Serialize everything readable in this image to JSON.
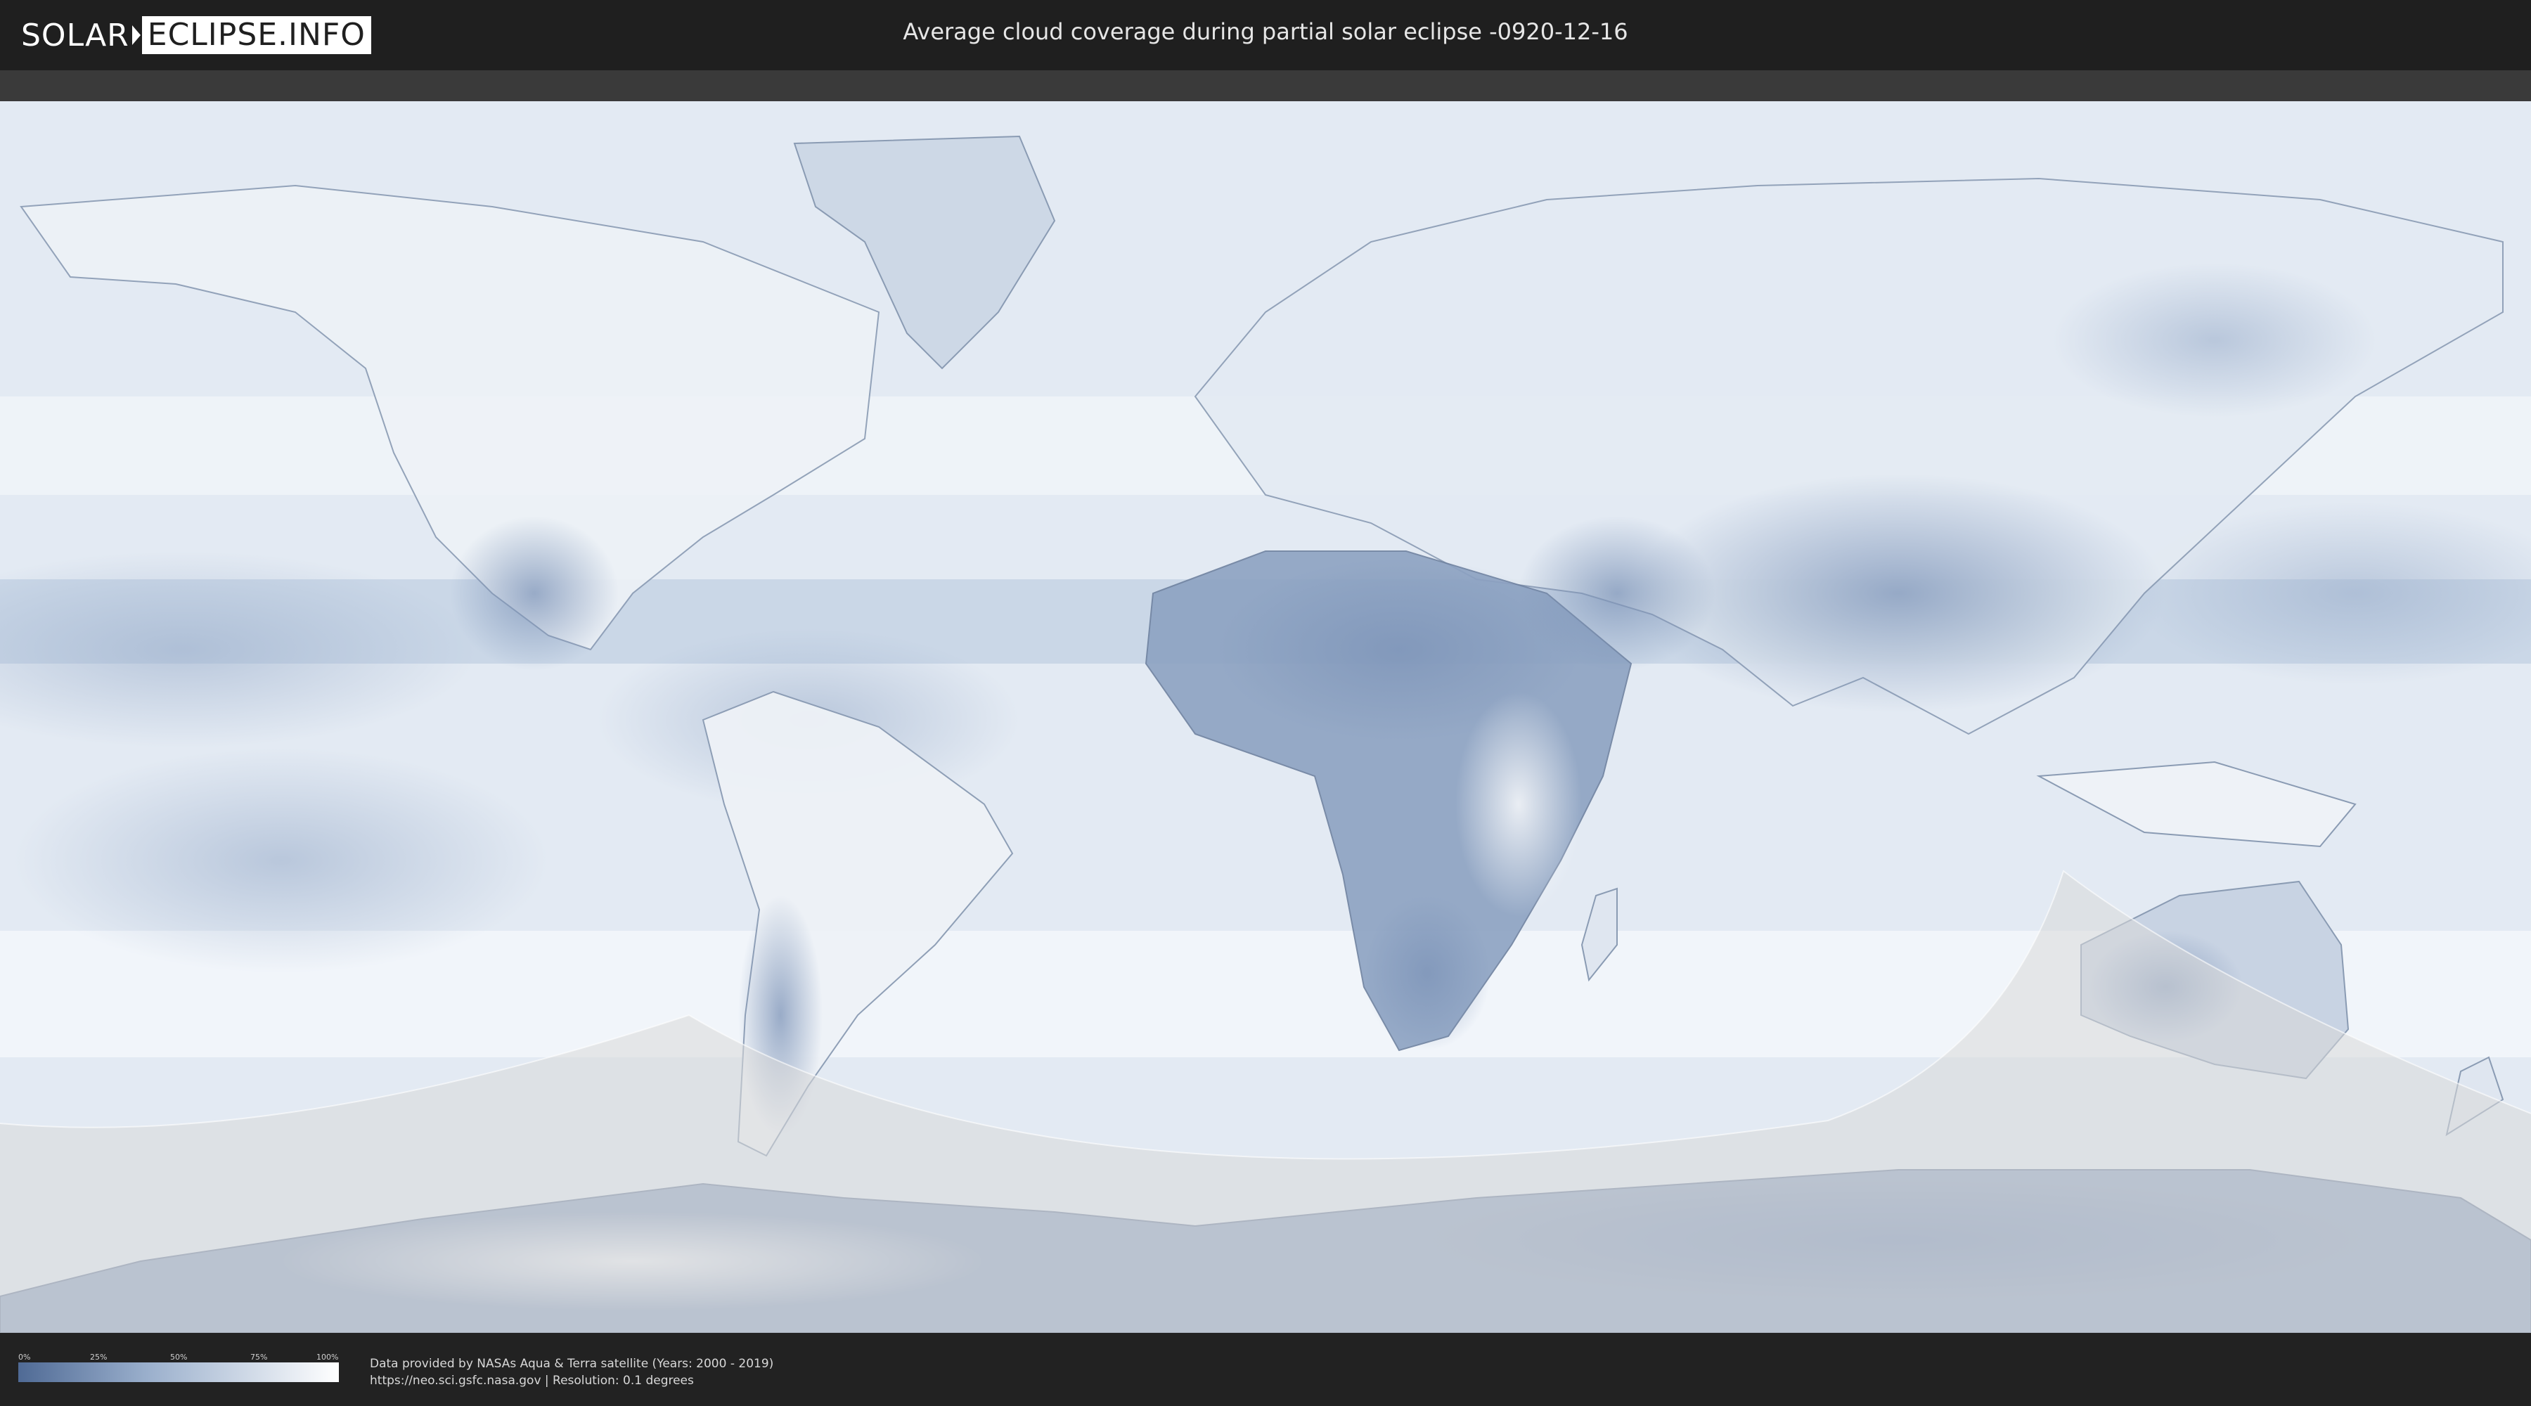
{
  "header": {
    "logo_left": "SOLAR",
    "logo_right": "ECLIPSE.INFO",
    "title": "Average cloud coverage during partial solar eclipse -0920-12-16"
  },
  "legend": {
    "ticks": [
      "0%",
      "25%",
      "50%",
      "75%",
      "100%"
    ],
    "colors": {
      "low": "#4f6a95",
      "mid": "#9aafcc",
      "high": "#ffffff"
    }
  },
  "footer": {
    "source_line1": "Data provided by NASAs Aqua & Terra satellite (Years: 2000 - 2019)",
    "source_line2": "https://neo.sci.gsfc.nasa.gov | Resolution: 0.1 degrees"
  },
  "map": {
    "projection": "equirectangular",
    "eclipse_region": "southern hemisphere",
    "colors": {
      "ocean": "#e3eaf3",
      "land_dark": "#7d94b8",
      "land_light": "#eef2f7",
      "eclipse_shade": "#dcdcdc"
    }
  }
}
